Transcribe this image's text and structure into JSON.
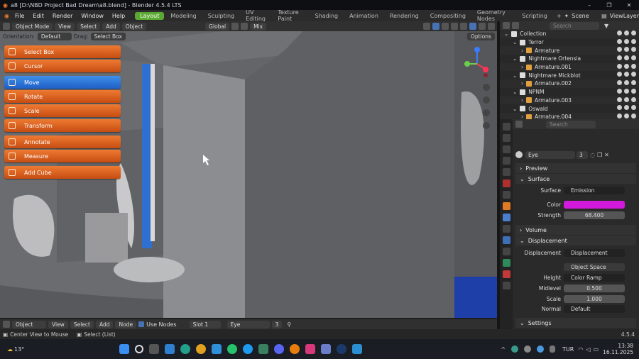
{
  "titlebar": {
    "title": "a8 [D:\\NBD Project Bad Dream\\a8.blend] - Blender 4.5.4 LTS",
    "minimize": "–",
    "maximize": "❐",
    "close": "✕"
  },
  "menubar": {
    "menus": [
      "File",
      "Edit",
      "Render",
      "Window",
      "Help"
    ],
    "workspaces": [
      "Layout",
      "Modeling",
      "Sculpting",
      "UV Editing",
      "Texture Paint",
      "Shading",
      "Animation",
      "Rendering",
      "Compositing",
      "Geometry Nodes",
      "Scripting"
    ],
    "add_workspace": "+",
    "scene": "Scene",
    "view_layer": "ViewLayer"
  },
  "viewport_header": {
    "mode": "Object Mode",
    "menus": [
      "View",
      "Select",
      "Add",
      "Object"
    ],
    "transform": "Global",
    "shading_label": "Mix",
    "options": "Options",
    "orientation_label": "Orientation:",
    "orientation_value": "Default",
    "drag_label": "Drag:",
    "drag_value": "Select Box"
  },
  "toolbar": [
    {
      "label": "Select Box",
      "active": false
    },
    {
      "label": "Cursor",
      "active": false
    },
    {
      "label": "Move",
      "active": true
    },
    {
      "label": "Rotate",
      "active": false
    },
    {
      "label": "Scale",
      "active": false
    },
    {
      "label": "Transform",
      "active": false
    },
    {
      "label": "Annotate",
      "active": false
    },
    {
      "label": "Measure",
      "active": false
    },
    {
      "label": "Add Cube",
      "active": false
    }
  ],
  "outliner": {
    "search_placeholder": "Search",
    "rows": [
      {
        "label": "Collection",
        "indent": 0
      },
      {
        "label": "Terror",
        "indent": 1
      },
      {
        "label": "Armature",
        "indent": 2
      },
      {
        "label": "Nightmare Ortensia",
        "indent": 1
      },
      {
        "label": "Armature.001",
        "indent": 2
      },
      {
        "label": "Nightmare Mickblot",
        "indent": 1
      },
      {
        "label": "Armature.002",
        "indent": 2
      },
      {
        "label": "NPNM",
        "indent": 1
      },
      {
        "label": "Armature.003",
        "indent": 2
      },
      {
        "label": "Oswald",
        "indent": 1
      },
      {
        "label": "Armature.004",
        "indent": 2
      }
    ]
  },
  "properties": {
    "search_placeholder": "Search",
    "material_name": "Eye",
    "users": "3",
    "sections": {
      "preview": "Preview",
      "surface": "Surface",
      "volume": "Volume",
      "displacement": "Displacement",
      "settings": "Settings"
    },
    "surface": {
      "label": "Surface",
      "value": "Emission"
    },
    "color": {
      "label": "Color",
      "value": "#d21adc"
    },
    "strength": {
      "label": "Strength",
      "value": "68.400"
    },
    "disp": {
      "label": "Displacement",
      "value": "Displacement"
    },
    "space": {
      "value": "Object Space"
    },
    "height": {
      "label": "Height",
      "value": "Color Ramp"
    },
    "midlevel": {
      "label": "Midlevel",
      "value": "0.500"
    },
    "scale": {
      "label": "Scale",
      "value": "1.000"
    },
    "normal": {
      "label": "Normal",
      "value": "Default"
    }
  },
  "node_header": {
    "object": "Object",
    "menus": [
      "View",
      "Select",
      "Add",
      "Node"
    ],
    "use_nodes": "Use Nodes",
    "slot": "Slot 1",
    "material": "Eye",
    "users": "3"
  },
  "statusbar": {
    "hint1": "Center View to Mouse",
    "hint2": "Select (List)",
    "version": "4.5.4"
  },
  "taskbar": {
    "weather": "13°",
    "language": "TUR",
    "time": "13:38",
    "date": "16.11.2025"
  }
}
